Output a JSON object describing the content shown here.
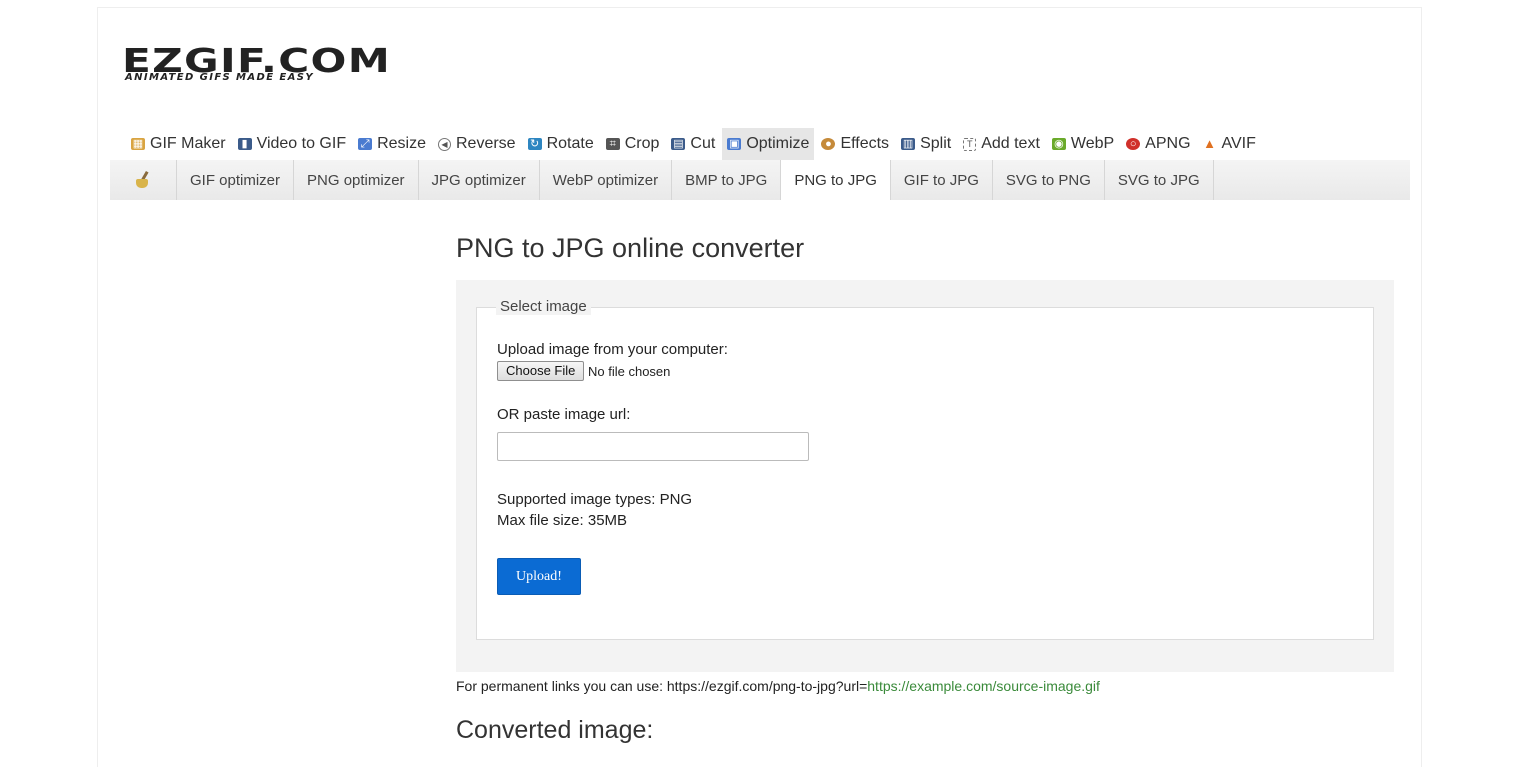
{
  "logo": {
    "main_text": "EZGIF.COM",
    "tagline": "ANIMATED GIFS MADE EASY"
  },
  "main_nav": [
    {
      "label": "GIF Maker",
      "icon": "gif-maker-icon",
      "color": "#d9a441"
    },
    {
      "label": "Video to GIF",
      "icon": "film-icon",
      "color": "#3b5b8a"
    },
    {
      "label": "Resize",
      "icon": "resize-icon",
      "color": "#4a7bd0"
    },
    {
      "label": "Reverse",
      "icon": "reverse-icon",
      "color": "#555555"
    },
    {
      "label": "Rotate",
      "icon": "rotate-icon",
      "color": "#2e86c1"
    },
    {
      "label": "Crop",
      "icon": "crop-icon",
      "color": "#555555"
    },
    {
      "label": "Cut",
      "icon": "cut-icon",
      "color": "#3b5b8a"
    },
    {
      "label": "Optimize",
      "icon": "optimize-icon",
      "color": "#4a7bd0",
      "active": true
    },
    {
      "label": "Effects",
      "icon": "palette-icon",
      "color": "#c58a3a"
    },
    {
      "label": "Split",
      "icon": "split-icon",
      "color": "#3b5b8a"
    },
    {
      "label": "Add text",
      "icon": "add-text-icon",
      "color": "#777777"
    },
    {
      "label": "WebP",
      "icon": "webp-icon",
      "color": "#6aaa2a"
    },
    {
      "label": "APNG",
      "icon": "apng-icon",
      "color": "#d0302a"
    },
    {
      "label": "AVIF",
      "icon": "avif-icon",
      "color": "#e07020"
    }
  ],
  "sub_nav": [
    {
      "label": "GIF optimizer"
    },
    {
      "label": "PNG optimizer"
    },
    {
      "label": "JPG optimizer"
    },
    {
      "label": "WebP optimizer"
    },
    {
      "label": "BMP to JPG"
    },
    {
      "label": "PNG to JPG",
      "active": true
    },
    {
      "label": "GIF to JPG"
    },
    {
      "label": "SVG to PNG"
    },
    {
      "label": "SVG to JPG"
    }
  ],
  "page_title": "PNG to JPG online converter",
  "form": {
    "legend": "Select image",
    "upload_label": "Upload image from your computer:",
    "choose_file_label": "Choose File",
    "file_status": "No file chosen",
    "url_label": "OR paste image url:",
    "url_value": "",
    "supported_types": "Supported image types: PNG",
    "max_size": "Max file size: 35MB",
    "upload_button": "Upload!"
  },
  "permalink": {
    "prefix": "For permanent links you can use: https://ezgif.com/png-to-jpg?url=",
    "link": "https://example.com/source-image.gif"
  },
  "converted_heading": "Converted image:",
  "colors": {
    "accent": "#0b6bd3",
    "link": "#3a8a3a",
    "panel_bg": "#f3f3f3"
  }
}
